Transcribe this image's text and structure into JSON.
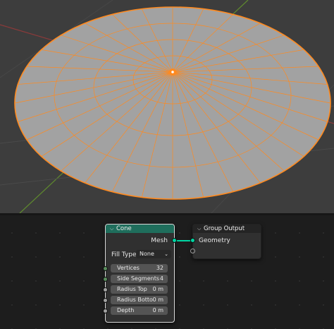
{
  "colors": {
    "mesh_fill": "#a2a2a2",
    "selection_edge": "#ff8a1f",
    "viewport_bg": "#3d3d3d",
    "node_editor_bg": "#1d1d1d",
    "cone_header": "#1f6e5c",
    "geometry_socket": "#00d6a3"
  },
  "cone_node": {
    "title": "Cone",
    "output_label": "Mesh",
    "fill_type_label": "Fill Type",
    "fill_type_value": "None",
    "inputs": [
      {
        "label": "Vertices",
        "value": "32"
      },
      {
        "label": "Side Segments",
        "value": "4"
      },
      {
        "label": "Radius Top",
        "value": "0 m"
      },
      {
        "label": "Radius Botto",
        "value": "0 m"
      },
      {
        "label": "Depth",
        "value": "0 m"
      }
    ]
  },
  "group_output_node": {
    "title": "Group Output",
    "input_label": "Geometry"
  }
}
